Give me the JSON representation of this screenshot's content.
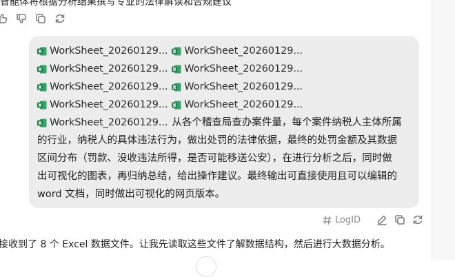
{
  "top_message": {
    "text": "智能体将根据分析结果撰写专业的法律解读和合规建议"
  },
  "user_message": {
    "files": [
      [
        "WorkSheet_20260129...",
        "WorkSheet_20260129..."
      ],
      [
        "WorkSheet_20260129...",
        "WorkSheet_20260129..."
      ],
      [
        "WorkSheet_20260129...",
        "WorkSheet_20260129..."
      ],
      [
        "WorkSheet_20260129...",
        "WorkSheet_20260129..."
      ]
    ],
    "last_file": "WorkSheet_20260129...",
    "prompt_lines": [
      "从各个稽查局查办案件量，每个案件纳税人主体所属",
      "的行业，纳税人的具体违法行为，做出处罚的法律依据，最终的处罚金额及其数据",
      "区间分布（罚款、没收违法所得，是否可能移送公安），在进行分析之后，同时做",
      "出可视化的图表，再归纳总结，给出操作建议。最终输出可直接使用且可以编辑的",
      "word 文档，同时做出可视化的网页版本。"
    ],
    "log_id_label": "LogID"
  },
  "assistant_reply": {
    "text": "接收到了 8 个 Excel 数据文件。让我先读取这些文件了解数据结构，然后进行大数据分析。"
  },
  "colors": {
    "excel_green": "#1d7a45",
    "bubble_bg": "#ececec",
    "icon_gray": "#7a7a7a"
  },
  "icons": [
    "thumb-up-icon",
    "thumb-down-icon",
    "copy-icon",
    "refresh-icon",
    "excel-file-icon",
    "hash-icon",
    "edit-icon"
  ]
}
